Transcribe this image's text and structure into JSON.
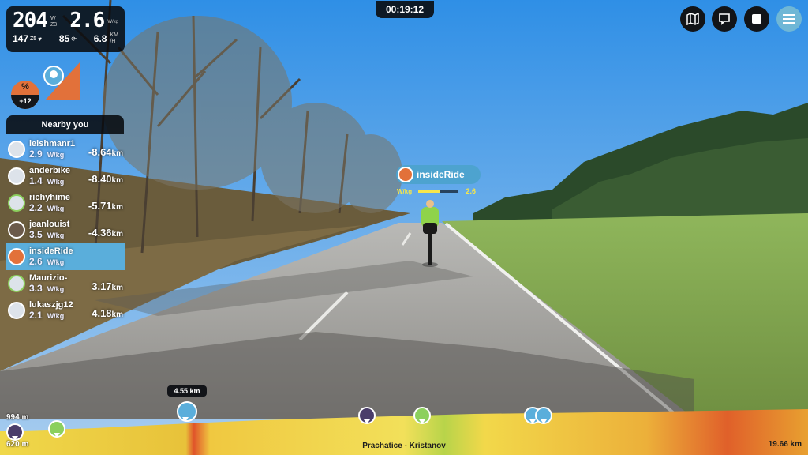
{
  "stats": {
    "power": "204",
    "power_zone": "Z3",
    "power_unit": "W",
    "wkg": "2.6",
    "wkg_unit": "W/kg",
    "heart_rate": "147",
    "hr_zone": "Z5",
    "cadence": "85",
    "speed": "6.8",
    "speed_unit_top": "KM",
    "speed_unit_bottom": "/H"
  },
  "timer": "00:19:12",
  "gradient": {
    "label": "%",
    "value": "+12"
  },
  "nearby": {
    "title": "Nearby you",
    "riders": [
      {
        "name": "leishmanr1",
        "wkg": "2.9",
        "unit": "W/kg",
        "dist": "-8.64",
        "dist_unit": "km"
      },
      {
        "name": "anderbike",
        "wkg": "1.4",
        "unit": "W/kg",
        "dist": "-8.40",
        "dist_unit": "km"
      },
      {
        "name": "richyhime",
        "wkg": "2.2",
        "unit": "W/kg",
        "dist": "-5.71",
        "dist_unit": "km"
      },
      {
        "name": "jeanlouist",
        "wkg": "3.5",
        "unit": "W/kg",
        "dist": "-4.36",
        "dist_unit": "km"
      },
      {
        "name": "insideRide",
        "wkg": "2.6",
        "unit": "W/kg",
        "dist": "",
        "dist_unit": ""
      },
      {
        "name": "Maurizio-",
        "wkg": "3.3",
        "unit": "W/kg",
        "dist": "3.17",
        "dist_unit": "km"
      },
      {
        "name": "lukaszjg12",
        "wkg": "2.1",
        "unit": "W/kg",
        "dist": "4.18",
        "dist_unit": "km"
      }
    ]
  },
  "scene_label": {
    "name": "insideRide",
    "wkg_label": "W/kg",
    "wkg": "2.6",
    "wkg_fraction": 0.55
  },
  "profile": {
    "max_elevation": "994 m",
    "min_elevation": "620 m",
    "route_name": "Prachatice - Kristanov",
    "route_length": "19.66 km",
    "position_tag": "4.55 km"
  },
  "colors": {
    "accent": "#5aaedb",
    "self": "#e2713a",
    "panel": "#0a0c10",
    "wkg_bar": "#f6e64a"
  },
  "icons": [
    "map-icon",
    "chat-icon",
    "stop-icon",
    "menu-icon"
  ]
}
